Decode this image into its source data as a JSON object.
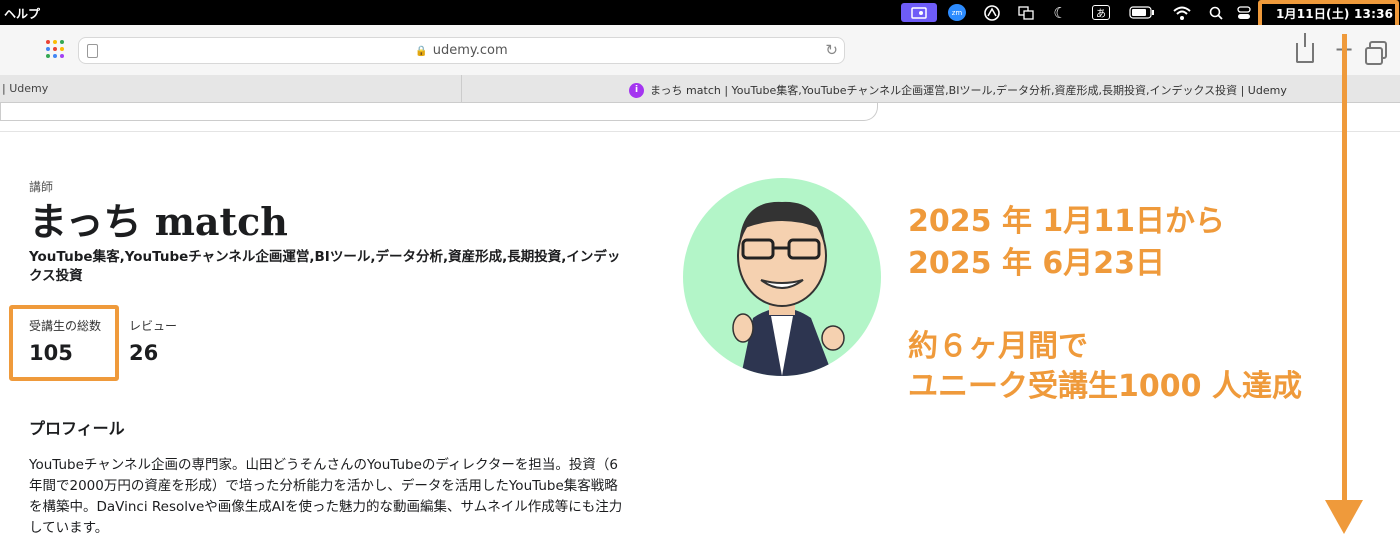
{
  "menubar": {
    "help_label": "ヘルプ",
    "input_mode": "あ",
    "clock": "1月11日(土)  13:36",
    "icons": [
      "screen-share-icon",
      "zoom-icon",
      "app-icon",
      "translate-icon",
      "moon-icon",
      "input-method-icon",
      "battery-icon",
      "wifi-icon",
      "search-icon",
      "control-center-icon"
    ]
  },
  "browser": {
    "url": "udemy.com",
    "tabs": [
      {
        "label": "| Udemy"
      },
      {
        "label": "まっち match | YouTube集客,YouTubeチャンネル企画運営,BIツール,データ分析,資産形成,長期投資,インデックス投資 | Udemy"
      }
    ]
  },
  "profile": {
    "role_label": "講師",
    "name": "まっち match",
    "headline": "YouTube集客,YouTubeチャンネル企画運営,BIツール,データ分析,資産形成,長期投資,インデックス投資",
    "stats": [
      {
        "label": "受講生の総数",
        "value": "105"
      },
      {
        "label": "レビュー",
        "value": "26"
      }
    ],
    "section_title": "プロフィール",
    "bio": "YouTubeチャンネル企画の専門家。山田どうそんさんのYouTubeのディレクターを担当。投資（6年間で2000万円の資産を形成）で培った分析能力を活かし、データを活用したYouTube集客戦略を構築中。DaVinci Resolveや画像生成AIを使った魅力的な動画編集、サムネイル作成等にも注力しています。"
  },
  "annotation": {
    "line1": "2025 年 1月11日から",
    "line2": "2025 年 6月23日",
    "line3": "約６ヶ月間で",
    "line4": "ユニーク受講生1000 人達成"
  },
  "colors": {
    "accent": "#ef9a3b",
    "avatar_bg": "#b3f5c8",
    "favicon": "#a435f0"
  }
}
